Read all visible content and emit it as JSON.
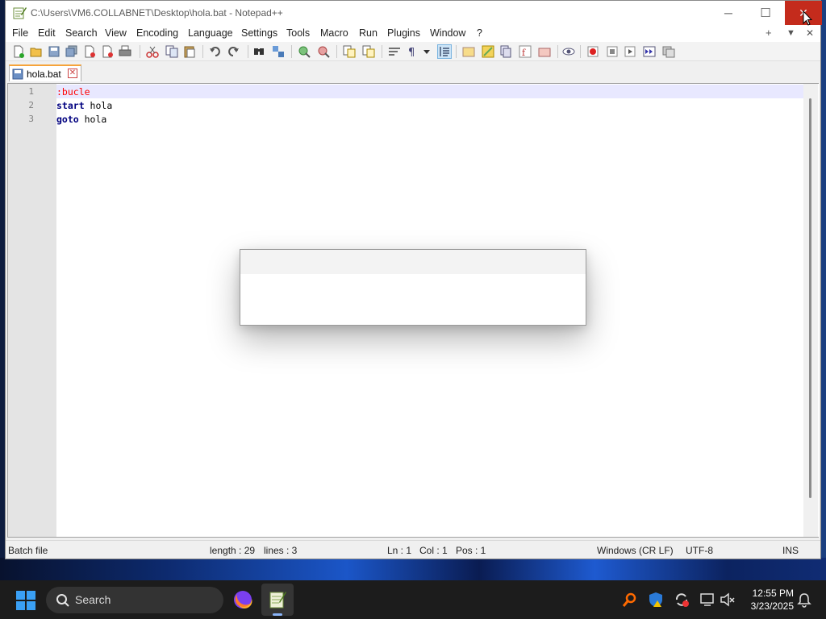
{
  "window": {
    "title": "C:\\Users\\VM6.COLLABNET\\Desktop\\hola.bat - Notepad++",
    "minimize_glyph": "─",
    "maximize_glyph": "☐",
    "close_glyph": "✕"
  },
  "menubar": {
    "items": [
      "File",
      "Edit",
      "Search",
      "View",
      "Encoding",
      "Language",
      "Settings",
      "Tools",
      "Macro",
      "Run",
      "Plugins",
      "Window",
      "?"
    ],
    "right": [
      "+",
      "▼",
      "✕"
    ]
  },
  "tab": {
    "label": "hola.bat",
    "close_glyph": "✕"
  },
  "editor": {
    "lines": [
      {
        "number": "1",
        "text": ":bucle"
      },
      {
        "number": "2",
        "keyword": "start",
        "rest": " hola"
      },
      {
        "number": "3",
        "keyword": "goto",
        "rest": " hola"
      }
    ]
  },
  "statusbar": {
    "file_type": "Batch file",
    "length": "length : 29",
    "lines": "lines : 3",
    "ln": "Ln : 1",
    "col": "Col : 1",
    "pos": "Pos : 1",
    "eol": "Windows (CR LF)",
    "encoding": "UTF-8",
    "mode": "INS"
  },
  "taskbar": {
    "search_placeholder": "Search",
    "time": "12:55 PM",
    "date": "3/23/2025"
  },
  "colors": {
    "close_button": "#c42b1c",
    "label_red": "#ff0000",
    "keyword_blue": "#00007f",
    "tab_accent": "#f6a33a",
    "taskbar": "#1c1c1c"
  }
}
